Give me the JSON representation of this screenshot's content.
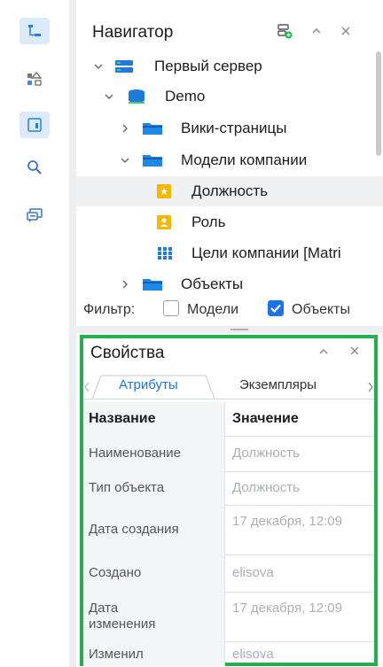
{
  "navigator": {
    "title": "Навигатор",
    "tree": [
      {
        "label": "Первый сервер",
        "icon": "server-icon",
        "expanded": true
      },
      {
        "label": "Demo",
        "icon": "database-icon",
        "expanded": true
      },
      {
        "label": "Вики-страницы",
        "icon": "folder-icon",
        "expanded": false
      },
      {
        "label": "Модели компании",
        "icon": "folder-icon",
        "expanded": true
      },
      {
        "label": "Должность",
        "icon": "position-model-icon",
        "selected": true
      },
      {
        "label": "Роль",
        "icon": "role-model-icon"
      },
      {
        "label": "Цели компании [Matri",
        "icon": "matrix-model-icon"
      },
      {
        "label": "Объекты",
        "icon": "folder-icon",
        "expanded": false
      }
    ],
    "filter": {
      "label": "Фильтр:",
      "models_label": "Модели",
      "models_checked": false,
      "objects_label": "Объекты",
      "objects_checked": true
    }
  },
  "properties": {
    "title": "Свойства",
    "tabs": [
      {
        "label": "Атрибуты",
        "active": true
      },
      {
        "label": "Экземпляры",
        "active": false
      }
    ],
    "columns": {
      "name": "Название",
      "value": "Значение"
    },
    "rows": [
      {
        "name": "Наименование",
        "value": "Должность"
      },
      {
        "name": "Тип объекта",
        "value": "Должность"
      },
      {
        "name": "Дата создания",
        "value": "17 декабря, 12:09"
      },
      {
        "name": "Создано",
        "value": "elisova"
      },
      {
        "name": "Дата изменения",
        "value": "17 декабря, 12:09"
      },
      {
        "name": "Изменил",
        "value": "elisova"
      }
    ]
  },
  "colors": {
    "accent": "#1a73e8",
    "folder": "#1e88e5",
    "highlight_frame": "#22b14c",
    "rail_active": "#dcebfa"
  }
}
